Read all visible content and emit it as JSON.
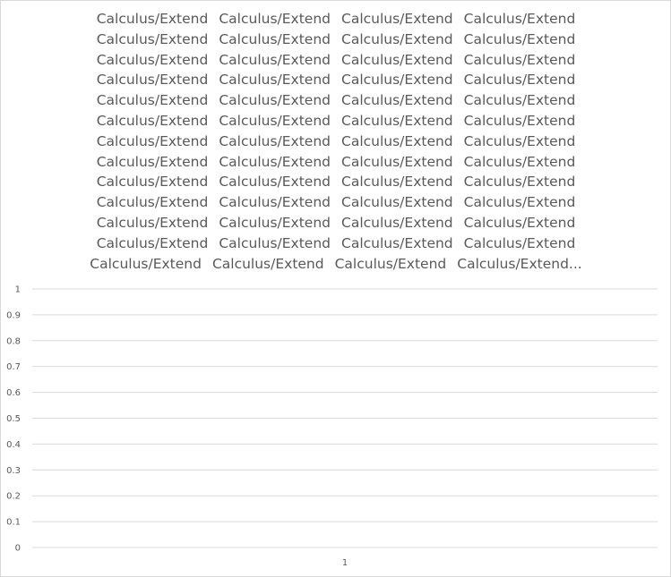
{
  "chart_data": {
    "type": "bar",
    "title_lines": [
      [
        "Calculus/Extend",
        "Calculus/Extend",
        "Calculus/Extend",
        "Calculus/Extend"
      ],
      [
        "Calculus/Extend",
        "Calculus/Extend",
        "Calculus/Extend",
        "Calculus/Extend"
      ],
      [
        "Calculus/Extend",
        "Calculus/Extend",
        "Calculus/Extend",
        "Calculus/Extend"
      ],
      [
        "Calculus/Extend",
        "Calculus/Extend",
        "Calculus/Extend",
        "Calculus/Extend"
      ],
      [
        "Calculus/Extend",
        "Calculus/Extend",
        "Calculus/Extend",
        "Calculus/Extend"
      ],
      [
        "Calculus/Extend",
        "Calculus/Extend",
        "Calculus/Extend",
        "Calculus/Extend"
      ],
      [
        "Calculus/Extend",
        "Calculus/Extend",
        "Calculus/Extend",
        "Calculus/Extend"
      ],
      [
        "Calculus/Extend",
        "Calculus/Extend",
        "Calculus/Extend",
        "Calculus/Extend"
      ],
      [
        "Calculus/Extend",
        "Calculus/Extend",
        "Calculus/Extend",
        "Calculus/Extend"
      ],
      [
        "Calculus/Extend",
        "Calculus/Extend",
        "Calculus/Extend",
        "Calculus/Extend"
      ],
      [
        "Calculus/Extend",
        "Calculus/Extend",
        "Calculus/Extend",
        "Calculus/Extend"
      ],
      [
        "Calculus/Extend",
        "Calculus/Extend",
        "Calculus/Extend",
        "Calculus/Extend"
      ],
      [
        "Calculus/Extend",
        "Calculus/Extend",
        "Calculus/Extend",
        "Calculus/Extend..."
      ]
    ],
    "categories": [
      "1"
    ],
    "values": [
      0
    ],
    "ylim": [
      0,
      1
    ],
    "y_ticks": [
      "0",
      "0.1",
      "0.2",
      "0.3",
      "0.4",
      "0.5",
      "0.6",
      "0.7",
      "0.8",
      "0.9",
      "1"
    ],
    "grid": true,
    "legend": "none",
    "colors": {
      "gridline": "#d9d9d9",
      "axis_text": "#595959",
      "title_text": "#595959",
      "border": "#d9d9d9"
    }
  }
}
